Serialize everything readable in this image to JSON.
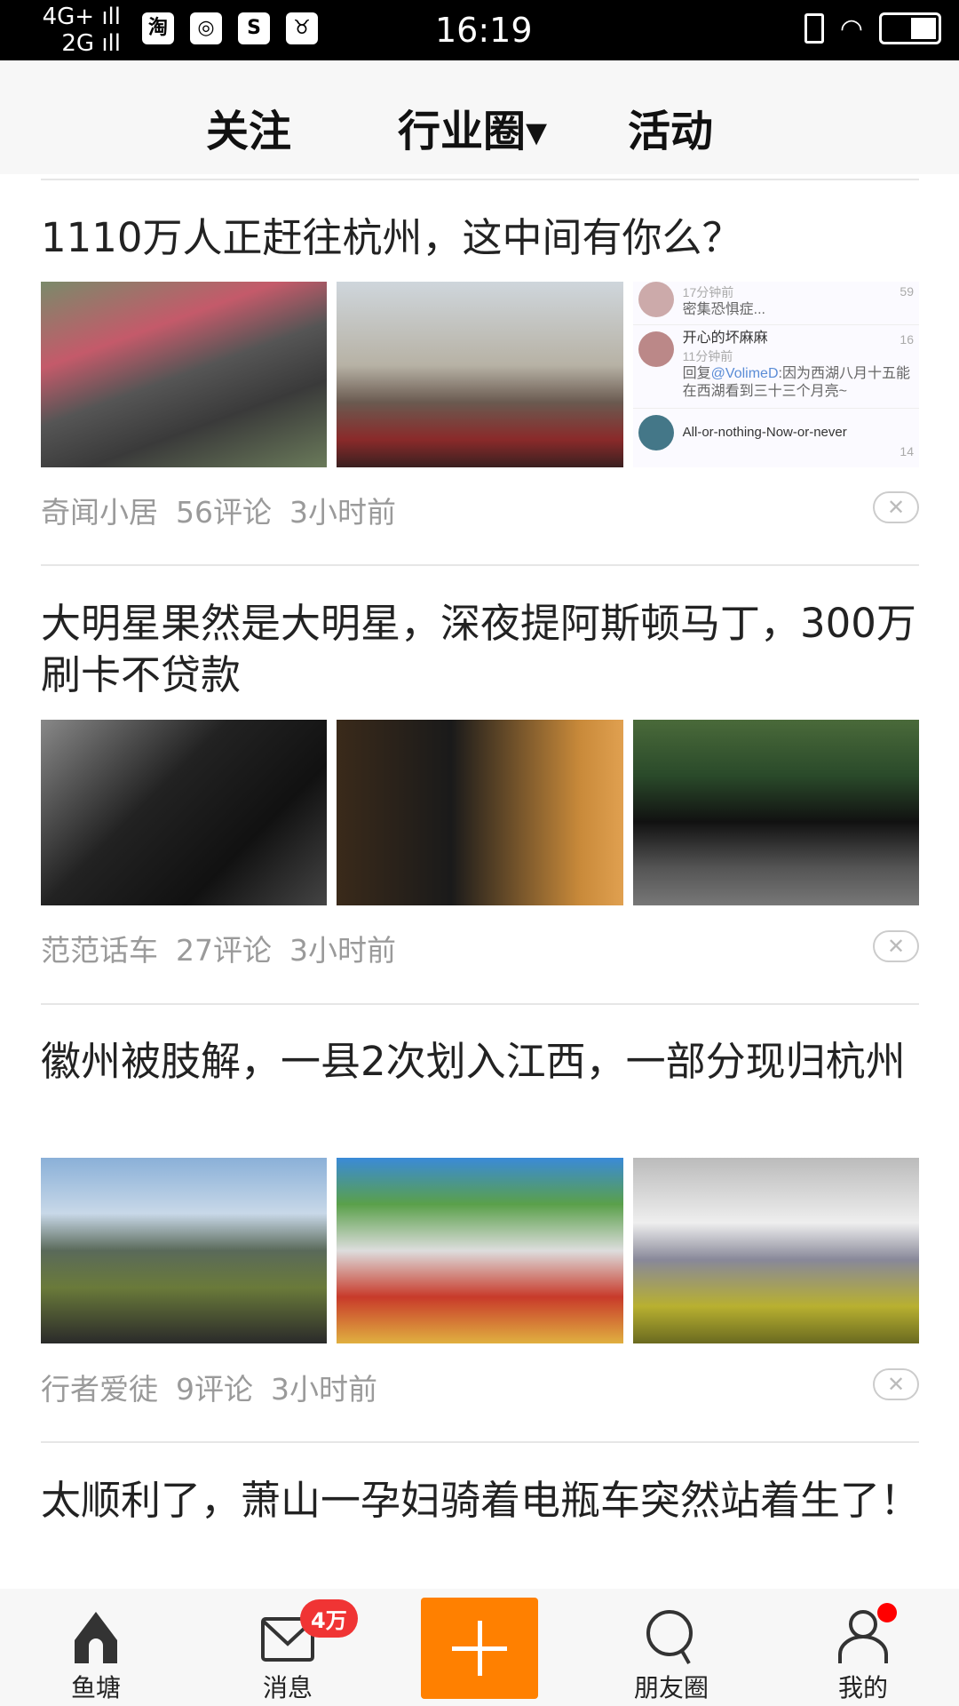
{
  "status": {
    "network_top": "4G+ ıll",
    "network_bottom": "2G ıll",
    "app_icons": [
      "淘",
      "◎",
      "S",
      "♉"
    ],
    "time": "16:19"
  },
  "header": {
    "tabs": [
      {
        "label": "关注"
      },
      {
        "label": "行业圈▾"
      },
      {
        "label": "活动"
      }
    ]
  },
  "posts": [
    {
      "title": "1110万人正赶往杭州，这中间有你么？",
      "source": "奇闻小居",
      "comments": "56评论",
      "time": "3小时前",
      "embedded_comments": [
        {
          "name": "",
          "time": "17分钟前",
          "text": "密集恐惧症...",
          "likes": "59"
        },
        {
          "name": "开心的坏麻麻",
          "time": "11分钟前",
          "reply_prefix": "回复",
          "mention": "@VolimeD",
          "text": ":因为西湖八月十五能在西湖看到三十三个月亮~",
          "likes": "16"
        },
        {
          "name": "All-or-nothing-Now-or-never",
          "likes": "14"
        }
      ]
    },
    {
      "title": "大明星果然是大明星，深夜提阿斯顿马丁，300万刷卡不贷款",
      "source": "范范话车",
      "comments": "27评论",
      "time": "3小时前"
    },
    {
      "title": "徽州被肢解，一县2次划入江西，一部分现归杭州",
      "source": "行者爱徒",
      "comments": "9评论",
      "time": "3小时前"
    },
    {
      "title": "太顺利了，萧山一孕妇骑着电瓶车突然站着生了！"
    }
  ],
  "close_label": "✕",
  "nav": {
    "items": [
      {
        "label": "鱼塘"
      },
      {
        "label": "消息",
        "badge": "4万"
      },
      {
        "label": ""
      },
      {
        "label": "朋友圈"
      },
      {
        "label": "我的"
      }
    ]
  },
  "colors": {
    "accent": "#ff8000",
    "badge": "#f03434"
  }
}
